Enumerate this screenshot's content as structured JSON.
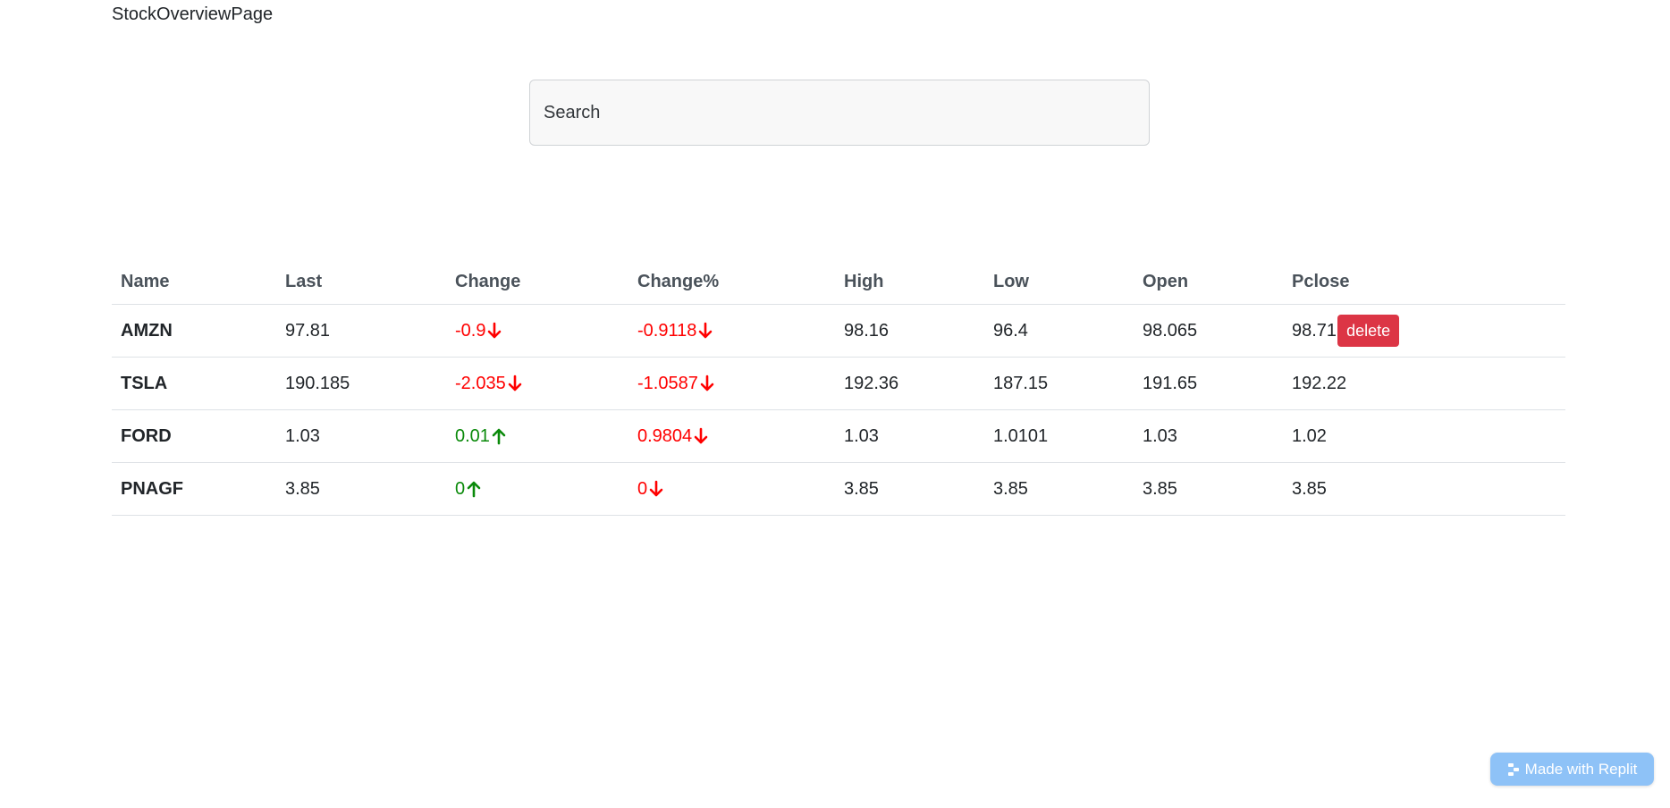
{
  "app": {
    "title": "StockOverviewPage"
  },
  "search": {
    "placeholder": "Search",
    "value": ""
  },
  "table": {
    "headers": {
      "name": "Name",
      "last": "Last",
      "change": "Change",
      "change_pct": "Change%",
      "high": "High",
      "low": "Low",
      "open": "Open",
      "pclose": "Pclose"
    },
    "rows": [
      {
        "name": "AMZN",
        "last": "97.81",
        "change": "-0.9",
        "change_dir": "down",
        "change_pct": "-0.9118",
        "change_pct_dir": "down",
        "high": "98.16",
        "low": "96.4",
        "open": "98.065",
        "pclose": "98.71",
        "delete_label": "delete"
      },
      {
        "name": "TSLA",
        "last": "190.185",
        "change": "-2.035",
        "change_dir": "down",
        "change_pct": "-1.0587",
        "change_pct_dir": "down",
        "high": "192.36",
        "low": "187.15",
        "open": "191.65",
        "pclose": "192.22"
      },
      {
        "name": "FORD",
        "last": "1.03",
        "change": "0.01",
        "change_dir": "up",
        "change_pct": "0.9804",
        "change_pct_dir": "down",
        "high": "1.03",
        "low": "1.0101",
        "open": "1.03",
        "pclose": "1.02"
      },
      {
        "name": "PNAGF",
        "last": "3.85",
        "change": "0",
        "change_dir": "up",
        "change_pct": "0",
        "change_pct_dir": "down",
        "high": "3.85",
        "low": "3.85",
        "open": "3.85",
        "pclose": "3.85"
      }
    ]
  },
  "badge": {
    "label": "Made with Replit",
    "icon": "replit-icon"
  },
  "colors": {
    "up": "#0a8a0a",
    "down": "#ff0000",
    "delete_button": "#dc3545",
    "badge": "#8ec2f7"
  }
}
